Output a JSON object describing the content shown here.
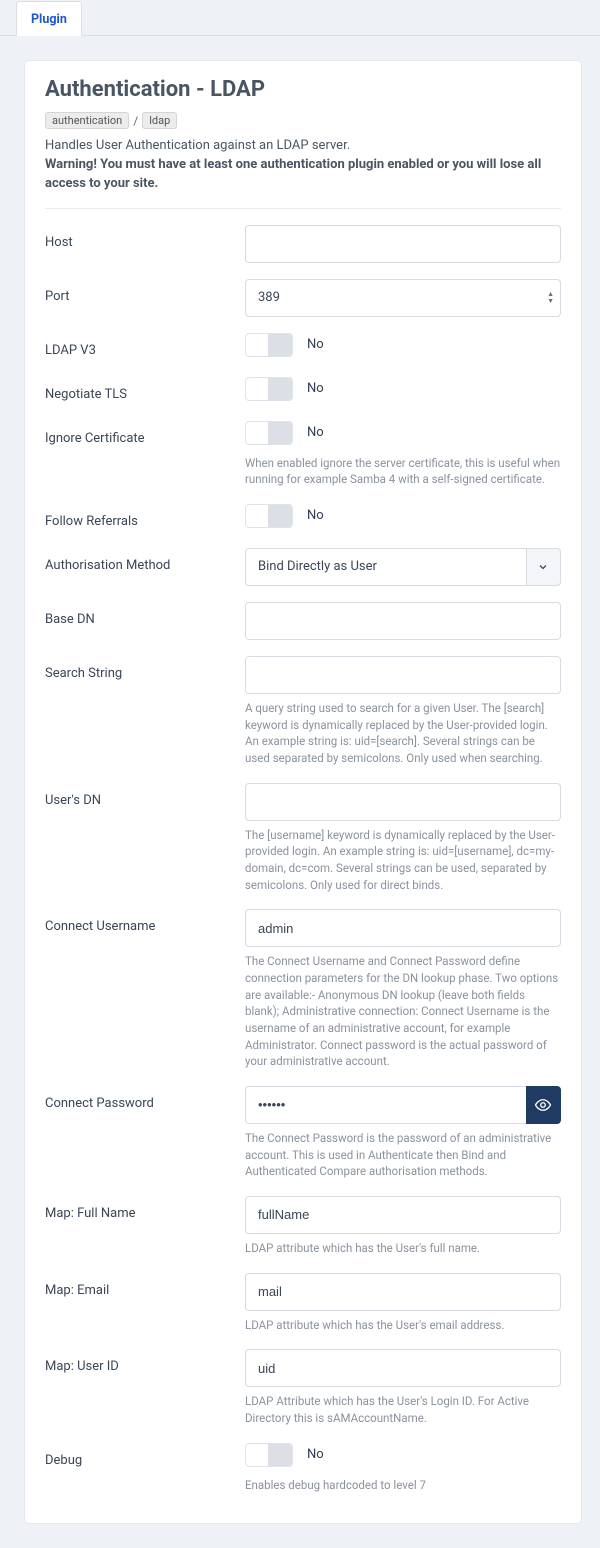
{
  "tab": {
    "label": "Plugin"
  },
  "header": {
    "title": "Authentication - LDAP",
    "breadcrumb": [
      "authentication",
      "ldap"
    ],
    "description": "Handles User Authentication against an LDAP server.",
    "warning": "Warning! You must have at least one authentication plugin enabled or you will lose all access to your site."
  },
  "toggle_state_text": "No",
  "fields": {
    "host": {
      "label": "Host",
      "value": ""
    },
    "port": {
      "label": "Port",
      "value": "389"
    },
    "ldapv3": {
      "label": "LDAP V3",
      "value": false
    },
    "tls": {
      "label": "Negotiate TLS",
      "value": false
    },
    "ignore_cert": {
      "label": "Ignore Certificate",
      "value": false,
      "help": "When enabled ignore the server certificate, this is useful when running for example Samba 4 with a self-signed certificate."
    },
    "follow_referrals": {
      "label": "Follow Referrals",
      "value": false
    },
    "auth_method": {
      "label": "Authorisation Method",
      "value": "Bind Directly as User"
    },
    "base_dn": {
      "label": "Base DN",
      "value": ""
    },
    "search_string": {
      "label": "Search String",
      "value": "",
      "help": "A query string used to search for a given User. The [search] keyword is dynamically replaced by the User-provided login. An example string is: uid=[search]. Several strings can be used separated by semicolons. Only used when searching."
    },
    "users_dn": {
      "label": "User's DN",
      "value": "",
      "help": "The [username] keyword is dynamically replaced by the User-provided login. An example string is: uid=[username], dc=my-domain, dc=com. Several strings can be used, separated by semicolons. Only used for direct binds."
    },
    "connect_username": {
      "label": "Connect Username",
      "value": "admin",
      "help": "The Connect Username and Connect Password define connection parameters for the DN lookup phase. Two options are available:- Anonymous DN lookup (leave both fields blank); Administrative connection: Connect Username is the username of an administrative account, for example Administrator. Connect password is the actual password of your administrative account."
    },
    "connect_password": {
      "label": "Connect Password",
      "value_mask": "••••••",
      "help": "The Connect Password is the password of an administrative account. This is used in Authenticate then Bind and Authenticated Compare authorisation methods."
    },
    "map_fullname": {
      "label": "Map: Full Name",
      "value": "fullName",
      "help": "LDAP attribute which has the User's full name."
    },
    "map_email": {
      "label": "Map: Email",
      "value": "mail",
      "help": "LDAP attribute which has the User's email address."
    },
    "map_uid": {
      "label": "Map: User ID",
      "value": "uid",
      "help": "LDAP Attribute which has the User's Login ID. For Active Directory this is sAMAccountName."
    },
    "debug": {
      "label": "Debug",
      "value": false,
      "help": "Enables debug hardcoded to level 7"
    }
  }
}
